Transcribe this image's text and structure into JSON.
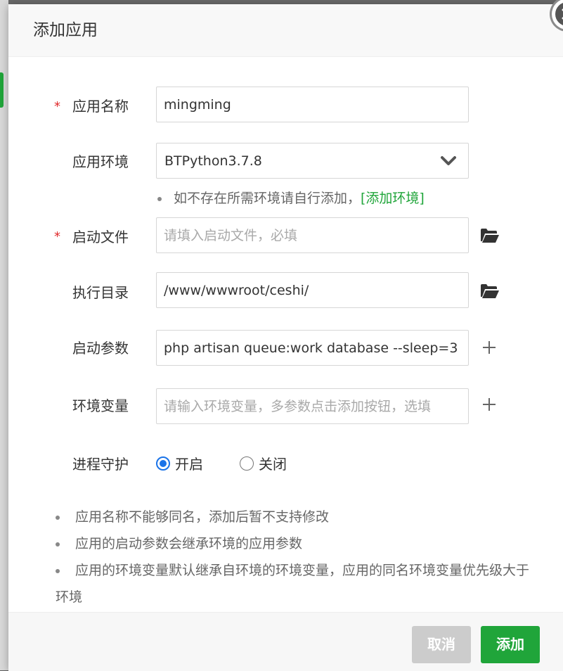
{
  "dialog": {
    "title": "添加应用"
  },
  "form": {
    "app_name": {
      "label": "应用名称",
      "value": "mingming",
      "required": true
    },
    "app_env": {
      "label": "应用环境",
      "value": "BTPython3.7.8"
    },
    "env_tip": {
      "text": "如不存在所需环境请自行添加，",
      "link": "[添加环境]"
    },
    "start_file": {
      "label": "启动文件",
      "value": "",
      "placeholder": "请填入启动文件，必填",
      "required": true
    },
    "exec_dir": {
      "label": "执行目录",
      "value": "/www/wwwroot/ceshi/"
    },
    "start_args": {
      "label": "启动参数",
      "value": "php artisan queue:work database --sleep=3"
    },
    "env_vars": {
      "label": "环境变量",
      "value": "",
      "placeholder": "请输入环境变量，多参数点击添加按钮，选填"
    },
    "daemon": {
      "label": "进程守护",
      "options": [
        "开启",
        "关闭"
      ],
      "selected": "开启"
    }
  },
  "notes": [
    "应用名称不能够同名，添加后暂不支持修改",
    "应用的启动参数会继承环境的应用参数",
    "应用的环境变量默认继承自环境的环境变量，应用的同名环境变量优先级大于环境"
  ],
  "buttons": {
    "cancel": "取消",
    "add": "添加"
  },
  "colors": {
    "accent_green": "#20a53a",
    "required_red": "#e0292b",
    "radio_blue": "#1a73e8"
  },
  "icons": {
    "close": "close-icon",
    "chevron": "chevron-down-icon",
    "folder": "folder-open-icon",
    "plus": "plus-icon"
  }
}
